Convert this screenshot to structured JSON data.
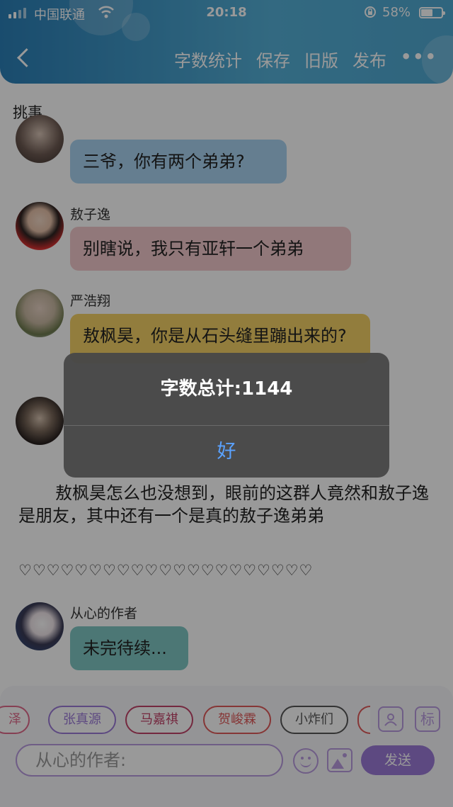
{
  "status_bar": {
    "carrier": "中国联通",
    "time": "20:18",
    "battery_percent": "58%",
    "battery_level": 0.58
  },
  "header": {
    "actions": [
      "字数统计",
      "保存",
      "旧版",
      "发布"
    ],
    "more": "•••",
    "colors": {
      "gradient_start": "#2b7fb7",
      "gradient_end": "#55b0d7"
    }
  },
  "story": {
    "title": "挑事"
  },
  "chat": {
    "messages": [
      {
        "text": "三爷，你有两个弟弟?",
        "color": "#a9d3f0"
      },
      {
        "speaker": "敖子逸",
        "text": "别瞎说，我只有亚轩一个弟弟",
        "color": "#f2c9cb"
      },
      {
        "speaker": "严浩翔",
        "text": "敖枫昊，你是从石头缝里蹦出来的?",
        "color": "#f3d167"
      },
      {
        "speaker": "从心的作者",
        "text": "未完待续...",
        "color": "#7fc7c4"
      }
    ],
    "narration": "敖枫昊怎么也没想到，眼前的这群人竟然和敖子逸是朋友，其中还有一个是真的敖子逸弟弟",
    "hearts": "♡♡♡♡♡♡♡♡♡♡♡♡♡♡♡♡♡♡♡♡♡"
  },
  "composer": {
    "chips": [
      {
        "label": "泽",
        "color": "#e06a8a"
      },
      {
        "label": "张真源",
        "color": "#9c7ad8"
      },
      {
        "label": "马嘉祺",
        "color": "#c24469"
      },
      {
        "label": "贺峻霖",
        "color": "#e05a5a"
      },
      {
        "label": "小炸们",
        "color": "#555555"
      }
    ],
    "tag_button_label": "标",
    "input_placeholder": "从心的作者:",
    "send_label": "发送",
    "accent": "#9c7ad8"
  },
  "dialog": {
    "message": "字数总计:1144",
    "ok_label": "好"
  }
}
